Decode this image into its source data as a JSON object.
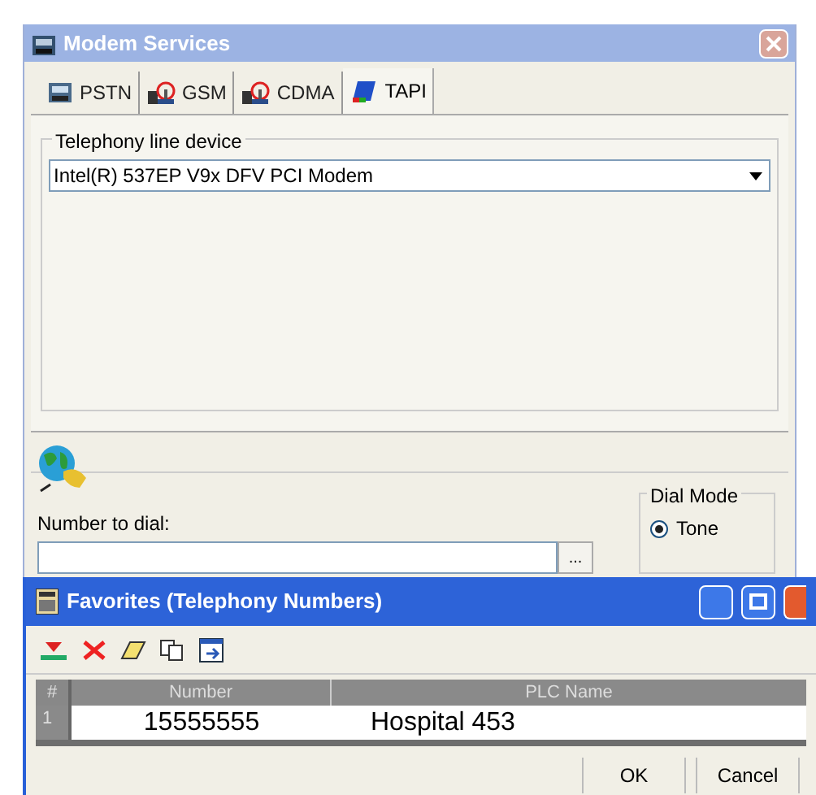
{
  "window": {
    "title": "Modem Services"
  },
  "tabs": [
    {
      "label": "PSTN",
      "kind": "phone",
      "selected": false
    },
    {
      "label": "GSM",
      "kind": "tower",
      "selected": false
    },
    {
      "label": "CDMA",
      "kind": "tower",
      "selected": false
    },
    {
      "label": "TAPI",
      "kind": "book",
      "selected": true
    }
  ],
  "line_device": {
    "label": "Telephony line device",
    "value": "Intel(R) 537EP V9x DFV PCI Modem"
  },
  "dial": {
    "label": "Number to dial:",
    "browse": "...",
    "dial_mode": {
      "label": "Dial Mode",
      "options": [
        {
          "label": "Tone",
          "selected": true
        }
      ]
    }
  },
  "favorites": {
    "title": "Favorites (Telephony Numbers)",
    "table": {
      "columns": [
        "#",
        "Number",
        "PLC Name"
      ],
      "rows": [
        [
          "1",
          "15555555",
          "Hospital 453"
        ]
      ]
    },
    "buttons": [
      "OK",
      "Cancel"
    ]
  }
}
